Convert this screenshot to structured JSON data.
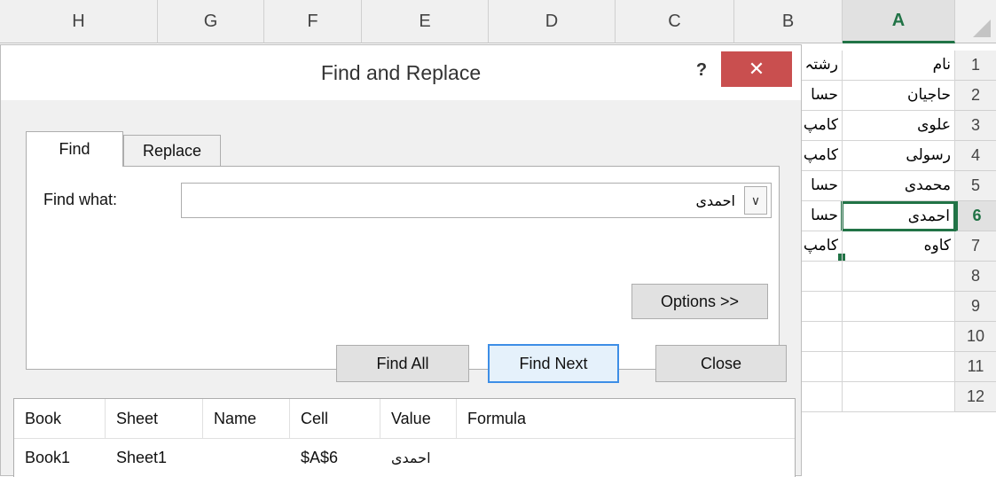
{
  "sheet": {
    "columns": [
      "H",
      "G",
      "F",
      "E",
      "D",
      "C",
      "B",
      "A"
    ],
    "rows": [
      "1",
      "2",
      "3",
      "4",
      "5",
      "6",
      "7",
      "8",
      "9",
      "10",
      "11",
      "12"
    ],
    "col_a": [
      "نام",
      "حاجیان",
      "علوی",
      "رسولی",
      "محمدی",
      "احمدی",
      "کاوه"
    ],
    "col_b": [
      "رشتہ",
      "حسا",
      "کامپ",
      "کامپ",
      "حسا",
      "حسا",
      "کامپ"
    ]
  },
  "dialog": {
    "title": "Find and Replace",
    "help": "?",
    "close": "✕",
    "tabs": {
      "find": "Find",
      "replace": "Replace"
    },
    "find_what_label": "Find what:",
    "find_value": "احمدی",
    "dropdown_glyph": "∨",
    "options": "Options >>",
    "buttons": {
      "find_all": "Find All",
      "find_next": "Find Next",
      "close": "Close"
    }
  },
  "results": {
    "headers": [
      "Book",
      "Sheet",
      "Name",
      "Cell",
      "Value",
      "Formula"
    ],
    "rows": [
      {
        "book": "Book1",
        "sheet": "Sheet1",
        "name": "",
        "cell": "$A$6",
        "value": "احمدی",
        "formula": ""
      }
    ]
  },
  "colors": {
    "excel_green": "#217346",
    "close_red": "#c94f4f",
    "default_blue": "#3d8ee6"
  }
}
